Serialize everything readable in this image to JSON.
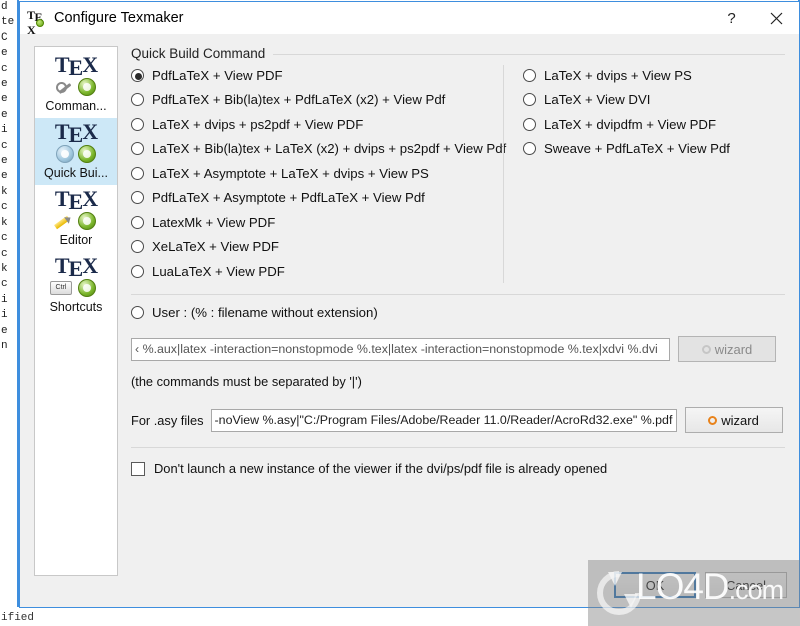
{
  "background": {
    "left_gutter_chars": [
      "d",
      "te",
      "",
      "",
      "C",
      "",
      "e",
      "c",
      "",
      "e",
      "e",
      "",
      "",
      "e",
      "i",
      "",
      "c",
      "",
      "e",
      "e",
      "",
      "k",
      "c",
      "",
      "k",
      "c",
      "c",
      "",
      "k",
      "c",
      "i",
      "",
      "i",
      "e",
      "n"
    ],
    "bottom_text": "ified"
  },
  "window": {
    "title": "Configure Texmaker",
    "icon": "tex-document-icon",
    "help_button": "?",
    "close_button": "×"
  },
  "sidebar": {
    "items": [
      {
        "label": "Comman...",
        "icon": "tex-wrench-icon",
        "selected": false
      },
      {
        "label": "Quick Bui...",
        "icon": "tex-gears-icon",
        "selected": true
      },
      {
        "label": "Editor",
        "icon": "tex-pencil-icon",
        "selected": false
      },
      {
        "label": "Shortcuts",
        "icon": "tex-ctrl-icon",
        "selected": false
      }
    ]
  },
  "main": {
    "group_title": "Quick Build Command",
    "radios_left": [
      {
        "label": "PdfLaTeX + View PDF",
        "checked": true
      },
      {
        "label": "PdfLaTeX + Bib(la)tex + PdfLaTeX (x2) + View Pdf",
        "checked": false
      },
      {
        "label": "LaTeX + dvips + ps2pdf + View PDF",
        "checked": false
      },
      {
        "label": "LaTeX + Bib(la)tex + LaTeX (x2) + dvips + ps2pdf + View Pdf",
        "checked": false
      },
      {
        "label": "LaTeX + Asymptote + LaTeX + dvips + View PS",
        "checked": false
      },
      {
        "label": "PdfLaTeX + Asymptote + PdfLaTeX + View Pdf",
        "checked": false
      },
      {
        "label": "LatexMk + View PDF",
        "checked": false
      },
      {
        "label": "XeLaTeX + View PDF",
        "checked": false
      },
      {
        "label": "LuaLaTeX + View PDF",
        "checked": false
      }
    ],
    "radios_right": [
      {
        "label": "LaTeX + dvips + View PS",
        "checked": false
      },
      {
        "label": "LaTeX + View DVI",
        "checked": false
      },
      {
        "label": "LaTeX + dvipdfm + View PDF",
        "checked": false
      },
      {
        "label": "Sweave + PdfLaTeX + View Pdf",
        "checked": false
      }
    ],
    "user_radio": {
      "label": "User : (% : filename without extension)",
      "checked": false
    },
    "user_command_value": "‹ %.aux|latex -interaction=nonstopmode %.tex|latex -interaction=nonstopmode %.tex|xdvi %.dvi",
    "user_wizard_label": "wizard",
    "user_wizard_icon": "gear-icon",
    "hint": "(the commands must be separated by '|')",
    "asy_label": "For .asy files",
    "asy_command_value": "-noView %.asy|\"C:/Program Files/Adobe/Reader 11.0/Reader/AcroRd32.exe\" %.pdf",
    "asy_wizard_label": "wizard",
    "asy_wizard_icon": "gear-icon",
    "checkbox_label": "Don't launch a new instance of the viewer if the dvi/ps/pdf file is already opened",
    "checkbox_checked": false
  },
  "footer": {
    "ok_label": "OK",
    "cancel_label": "Cancel"
  },
  "watermark": {
    "text": "LO4D",
    "domain": ".com"
  },
  "colors": {
    "accent": "#3e8ede",
    "selected_item": "#cde8f7",
    "dialog_bg": "#f0f0f0",
    "wizard_orange": "#e8821a"
  }
}
